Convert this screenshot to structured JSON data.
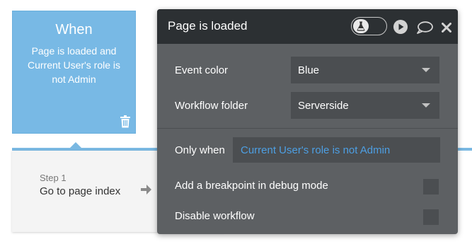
{
  "event_card": {
    "title": "When",
    "condition": "Page is loaded and Current User's role is not Admin",
    "icon": "trash-icon"
  },
  "step": {
    "number_label": "Step 1",
    "title": "Go to page index",
    "icon": "arrow-right-icon"
  },
  "panel": {
    "title": "Page is loaded",
    "header_icons": [
      "flask-icon",
      "play-icon",
      "comment-icon",
      "close-icon"
    ],
    "event_color": {
      "label": "Event color",
      "value": "Blue"
    },
    "workflow_folder": {
      "label": "Workflow folder",
      "value": "Serverside"
    },
    "only_when": {
      "label": "Only when",
      "expression": "Current User's role is not Admin"
    },
    "breakpoint": {
      "label": "Add a breakpoint in debug mode",
      "checked": false
    },
    "disable": {
      "label": "Disable workflow",
      "checked": false
    }
  },
  "colors": {
    "event_blue": "#78b9e5",
    "panel_bg": "#5d6063",
    "header_bg": "#2c3033",
    "field_bg": "#4b4e51",
    "expression_blue": "#4d9fe3"
  }
}
